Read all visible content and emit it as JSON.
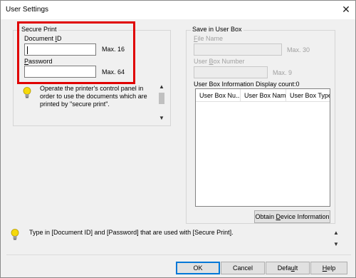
{
  "window": {
    "title": "User Settings",
    "close_glyph": "✕"
  },
  "secure_print": {
    "group_label": "Secure Print",
    "document_id": {
      "label_pre": "Document ",
      "label_u": "I",
      "label_post": "D",
      "value": "",
      "max": "Max. 16"
    },
    "password": {
      "label_u": "P",
      "label_post": "assword",
      "value": "",
      "max": "Max. 64"
    },
    "info_text": "Operate the printer's control panel in order to use the documents which are printed by \"secure print\"."
  },
  "save_in_user_box": {
    "group_label": "Save in User Box",
    "file_name": {
      "label_u": "F",
      "label_post": "ile Name",
      "max": "Max. 30"
    },
    "user_box_number": {
      "label_pre": "User ",
      "label_u": "B",
      "label_post": "ox Number",
      "max": "Max. 9"
    },
    "info_label": "User Box Information  Display count:0",
    "columns": [
      "User Box Nu...",
      "User Box Name",
      "User Box Type"
    ],
    "obtain_button": {
      "pre": "Obtain ",
      "u": "D",
      "post": "evice Information"
    }
  },
  "status_text": "Type in [Document ID] and [Password] that are used with [Secure Print].",
  "buttons": {
    "ok": "OK",
    "cancel": "Cancel",
    "default": {
      "pre": "Defa",
      "u": "u",
      "post": "lt"
    },
    "help": {
      "u": "H",
      "post": "elp"
    }
  },
  "colors": {
    "highlight": "#e00000",
    "accent": "#0078d7"
  }
}
